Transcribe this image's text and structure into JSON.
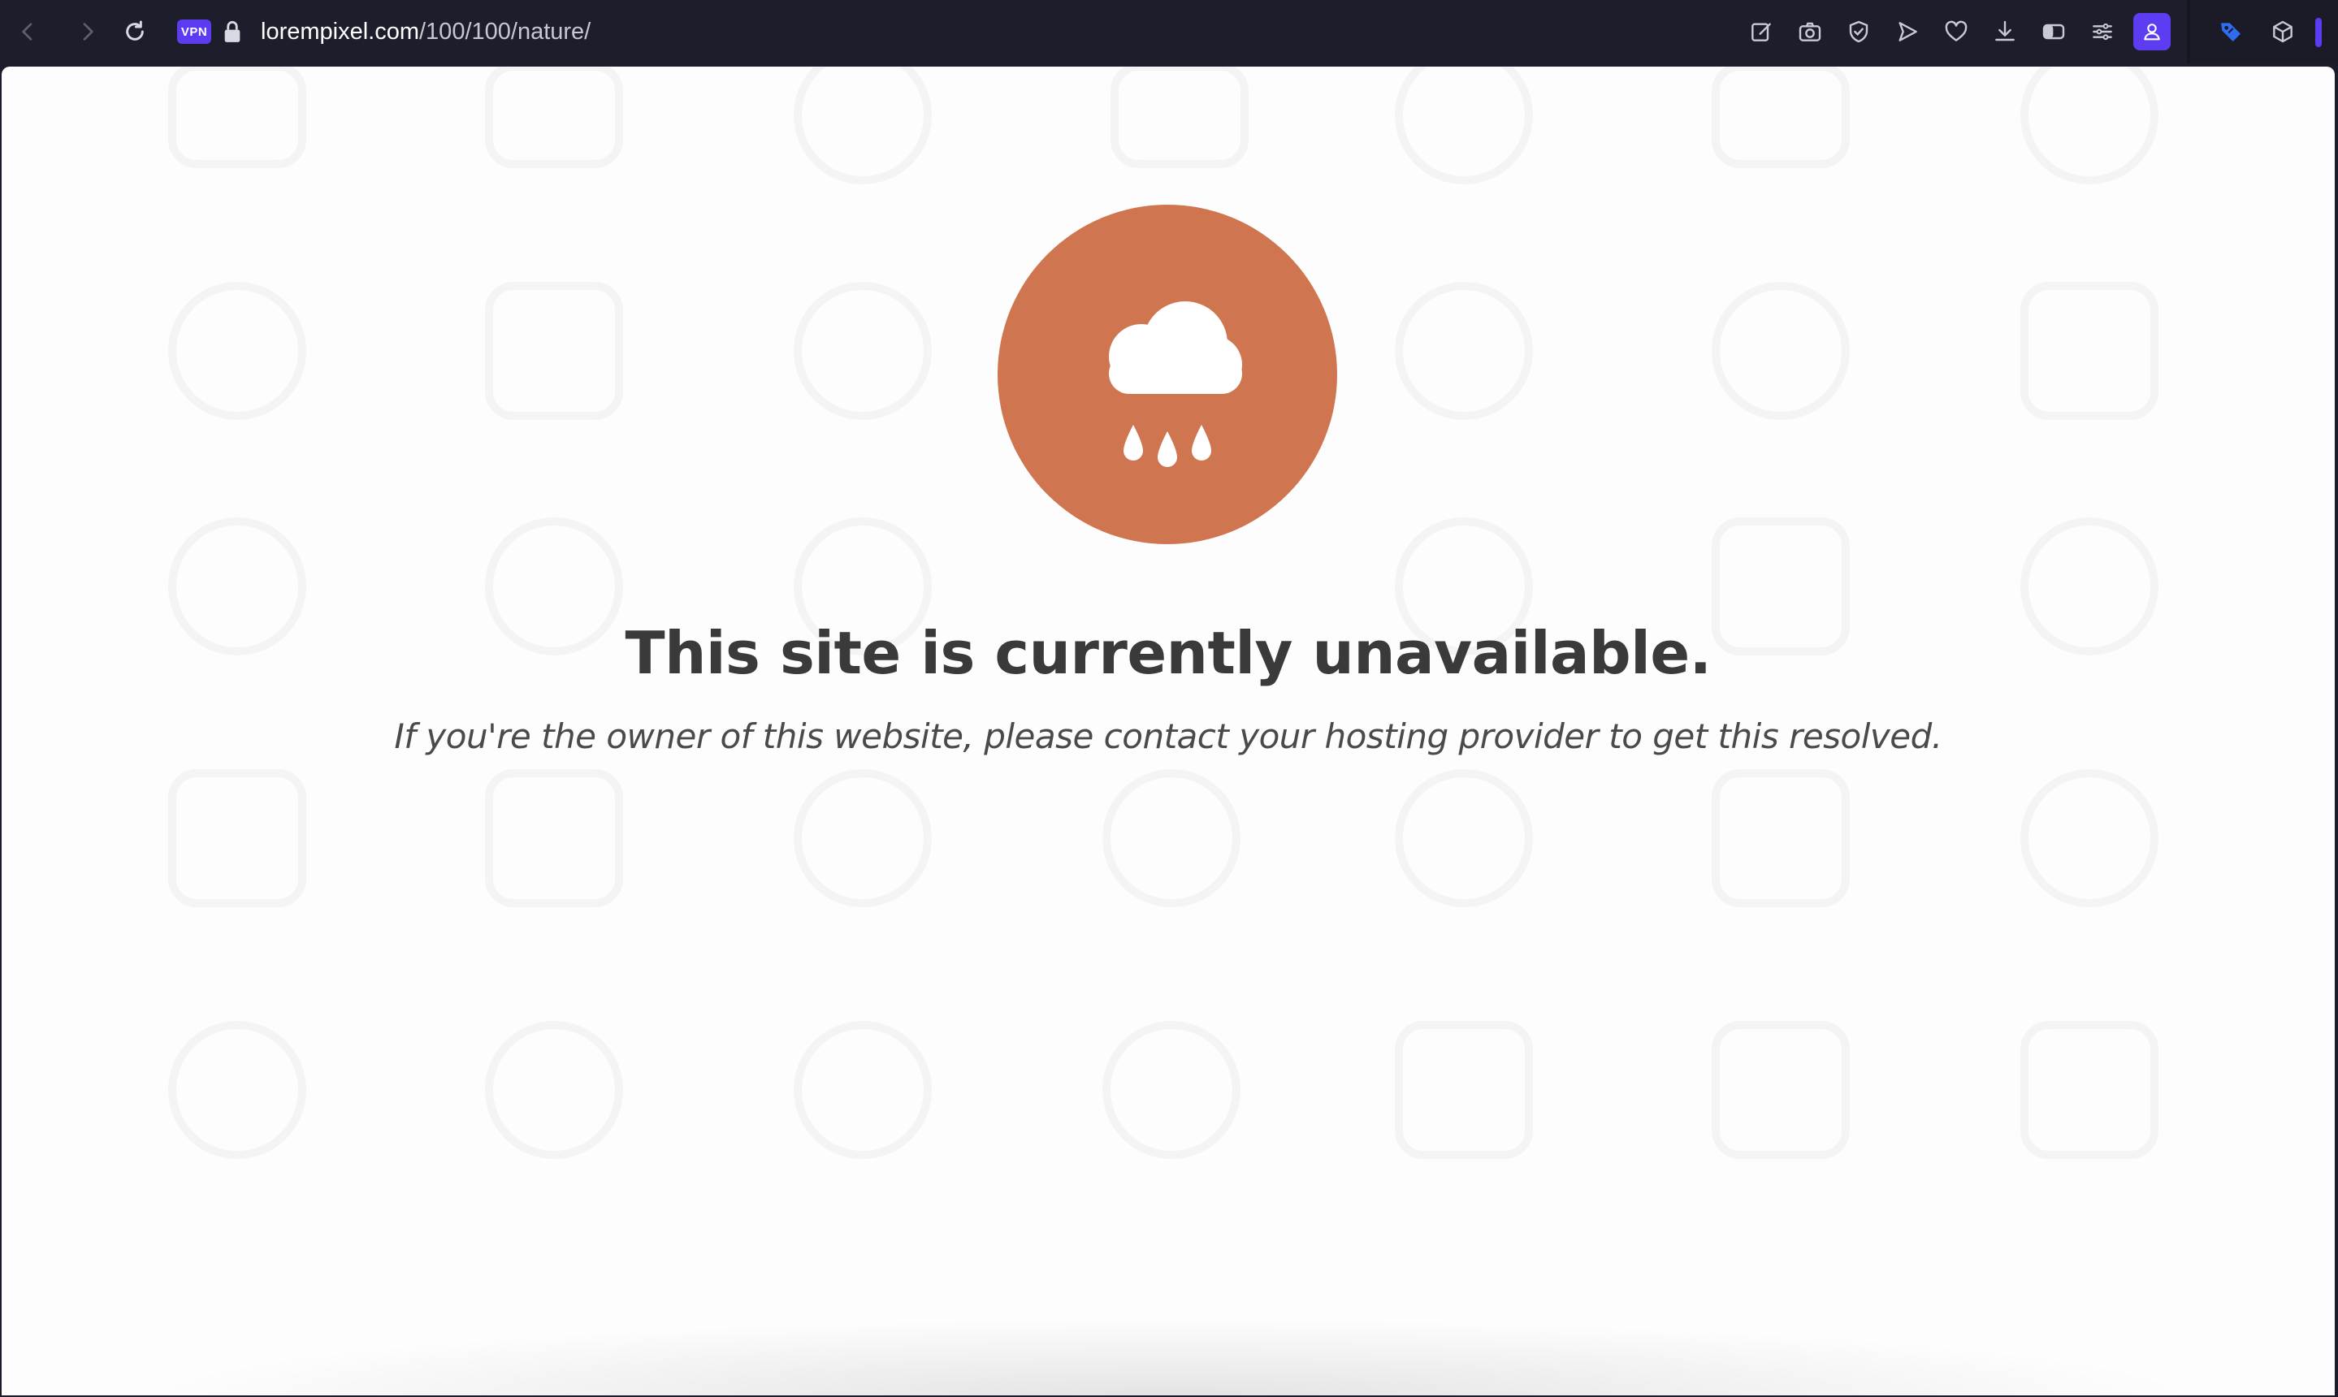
{
  "browser": {
    "url": {
      "host": "lorempixel.com",
      "path": "/100/100/nature/"
    },
    "vpn_label": "VPN",
    "accent_color": "#5c3bf0",
    "nav_icons": [
      "back-icon",
      "forward-icon",
      "reload-icon"
    ],
    "toolbar_icons": [
      "pen-icon",
      "camera-icon",
      "shield-icon",
      "send-icon",
      "heart-icon",
      "download-icon",
      "sidebar-icon",
      "menu-icon",
      "profile-icon",
      "tag-icon",
      "cube-icon"
    ]
  },
  "page": {
    "headline": "This site is currently unavailable.",
    "subtext": "If you're the owner of this website, please contact your hosting provider to get this resolved.",
    "status_icon": "cloud-rain-icon",
    "status_color": "#cf7651"
  }
}
